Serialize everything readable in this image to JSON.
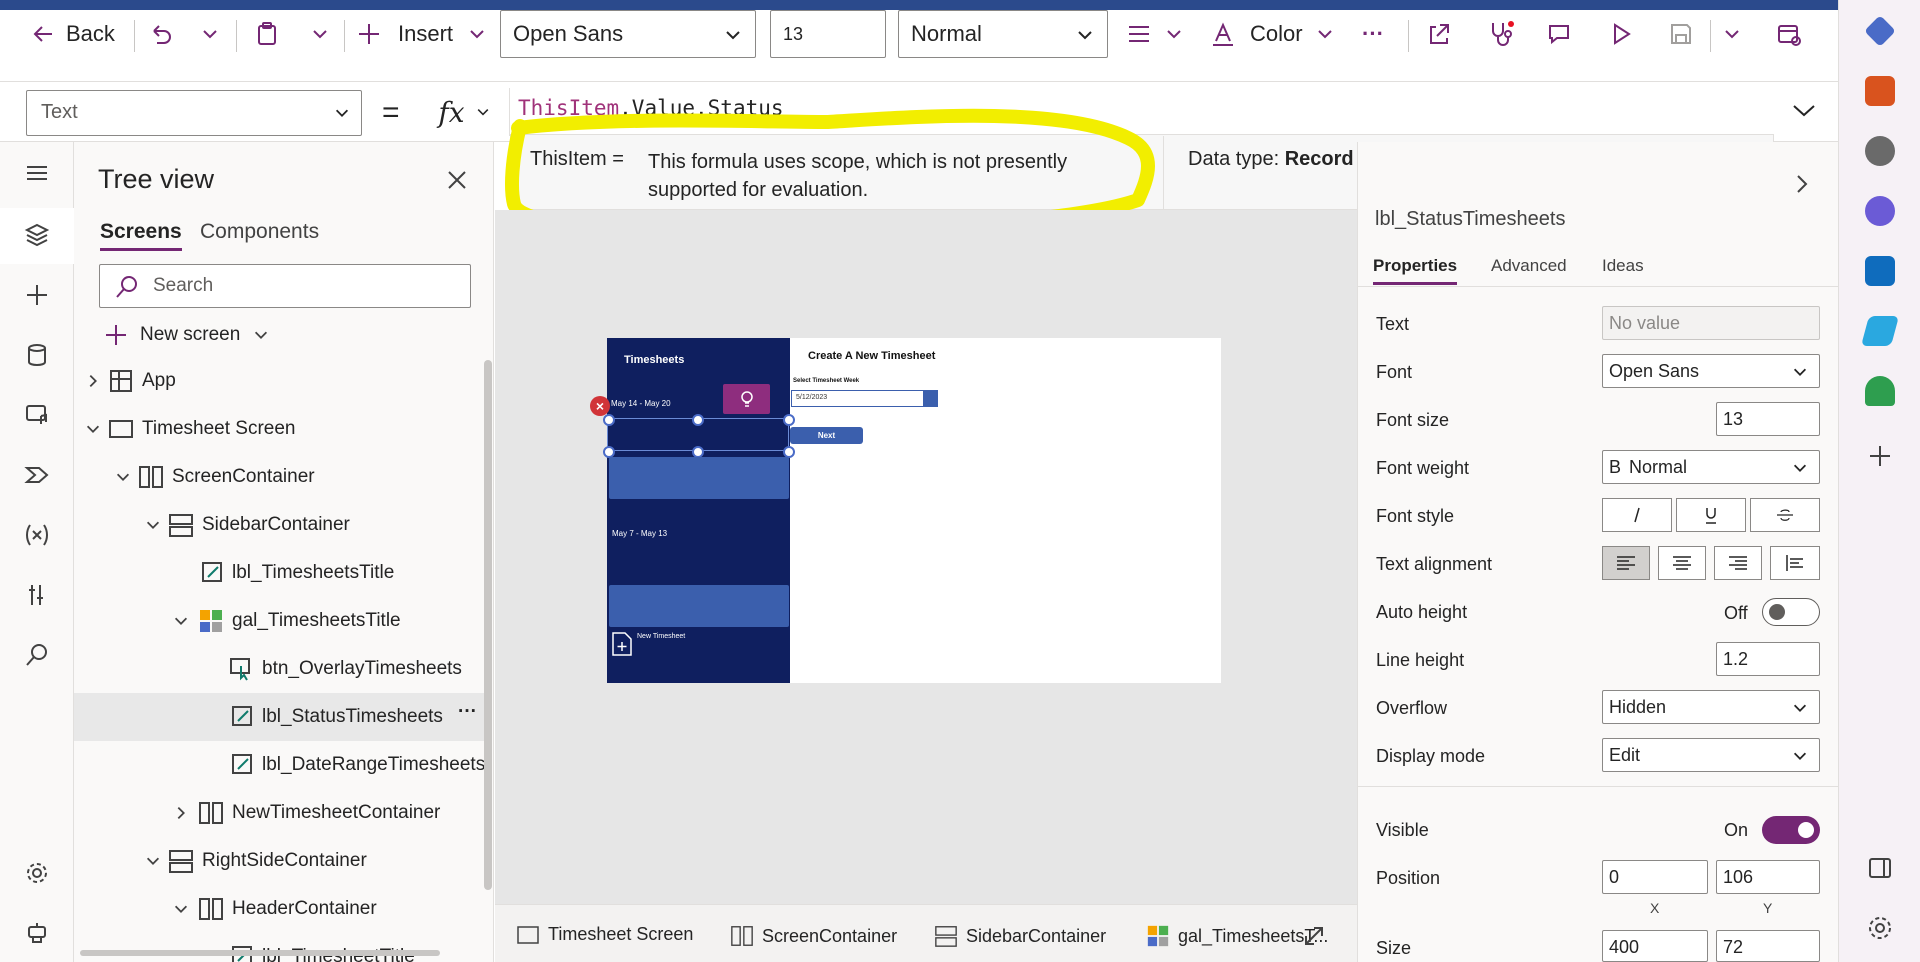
{
  "toolbar": {
    "back": "Back",
    "insert": "Insert",
    "font": "Open Sans",
    "font_size": "13",
    "font_weight": "Normal",
    "color": "Color",
    "more": "···"
  },
  "formula_bar": {
    "property": "Text",
    "equals": "=",
    "fx": "fx",
    "formula_keyword": "ThisItem",
    "formula_rest": ".Value.Status"
  },
  "tooltip": {
    "scope_label": "ThisItem  =",
    "message": "This formula uses scope, which is not presently supported for evaluation.",
    "data_type_label": "Data type:",
    "data_type_value": "Record"
  },
  "tree": {
    "title": "Tree view",
    "tabs": [
      "Screens",
      "Components"
    ],
    "search_placeholder": "Search",
    "new_screen": "New screen",
    "items": [
      {
        "label": "App",
        "level": 0
      },
      {
        "label": "Timesheet Screen",
        "level": 0
      },
      {
        "label": "ScreenContainer",
        "level": 1
      },
      {
        "label": "SidebarContainer",
        "level": 2
      },
      {
        "label": "lbl_TimesheetsTitle",
        "level": 3
      },
      {
        "label": "gal_TimesheetsTitle",
        "level": 3
      },
      {
        "label": "btn_OverlayTimesheets",
        "level": 4
      },
      {
        "label": "lbl_StatusTimesheets",
        "level": 4,
        "selected": true
      },
      {
        "label": "lbl_DateRangeTimesheets",
        "level": 4
      },
      {
        "label": "NewTimesheetContainer",
        "level": 3
      },
      {
        "label": "RightSideContainer",
        "level": 2
      },
      {
        "label": "HeaderContainer",
        "level": 3
      },
      {
        "label": "lbl_TimesheetTitle",
        "level": 4
      }
    ],
    "more": "···"
  },
  "app_preview": {
    "sidebar_title": "Timesheets",
    "item1": "May 14 - May 20",
    "item2": "May 7 - May 13",
    "new_timesheet": "New Timesheet",
    "header": "Create A New Timesheet",
    "select_week": "Select Timesheet Week",
    "date_value": "5/12/2023",
    "next": "Next",
    "error_mark": "×"
  },
  "breadcrumb": [
    "Timesheet Screen",
    "ScreenContainer",
    "SidebarContainer",
    "gal_TimesheetsT..."
  ],
  "properties": {
    "control_name": "lbl_StatusTimesheets",
    "tabs": [
      "Properties",
      "Advanced",
      "Ideas"
    ],
    "text_label": "Text",
    "text_value": "No value",
    "font_label": "Font",
    "font_value": "Open Sans",
    "font_size_label": "Font size",
    "font_size_value": "13",
    "font_weight_label": "Font weight",
    "font_weight_value": "Normal",
    "font_weight_prefix": "B",
    "font_style_label": "Font style",
    "text_alignment_label": "Text alignment",
    "auto_height_label": "Auto height",
    "auto_height_value": "Off",
    "line_height_label": "Line height",
    "line_height_value": "1.2",
    "overflow_label": "Overflow",
    "overflow_value": "Hidden",
    "display_mode_label": "Display mode",
    "display_mode_value": "Edit",
    "visible_label": "Visible",
    "visible_value": "On",
    "position_label": "Position",
    "position_x": "0",
    "position_y": "106",
    "x_label": "X",
    "y_label": "Y",
    "size_label": "Size",
    "size_w": "400",
    "size_h": "72"
  },
  "colors": {
    "accent": "#742774",
    "highlight": "#f2ee00",
    "app_sidebar": "#0f1f5f",
    "app_button": "#3b5fad"
  }
}
